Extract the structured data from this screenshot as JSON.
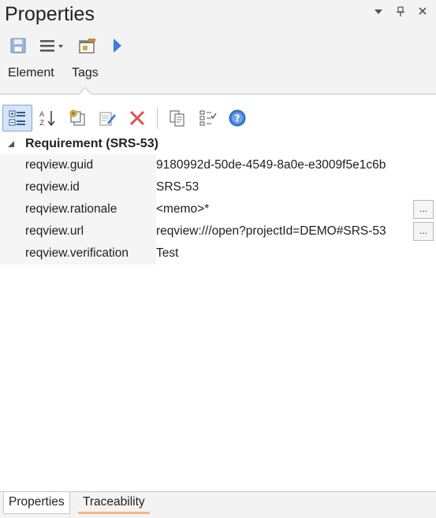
{
  "window": {
    "title": "Properties",
    "controls": {
      "menu": "▼",
      "pin": "📌",
      "close": "✕"
    }
  },
  "toolbar": {
    "icons": [
      "save-icon",
      "menu-list-icon",
      "dropdown-arrow-icon",
      "properties-window-icon",
      "play-icon"
    ]
  },
  "top_tabs": [
    {
      "label": "Element"
    },
    {
      "label": "Tags"
    }
  ],
  "tag_toolbar": {
    "icons": [
      "categorized-view-icon",
      "sort-alphabetical-icon",
      "new-tag-icon",
      "edit-tag-icon",
      "delete-icon",
      "copy-tags-icon",
      "tag-options-icon",
      "help-icon"
    ]
  },
  "grid": {
    "group": {
      "label": "Requirement (SRS-53)"
    },
    "rows": [
      {
        "name": "reqview.guid",
        "value": "9180992d-50de-4549-8a0e-e3009f5e1c6b"
      },
      {
        "name": "reqview.id",
        "value": "SRS-53"
      },
      {
        "name": "reqview.rationale",
        "value": "<memo>*",
        "button": "..."
      },
      {
        "name": "reqview.url",
        "value": "reqview:///open?projectId=DEMO#SRS-53",
        "button": "..."
      },
      {
        "name": "reqview.verification",
        "value": "Test"
      }
    ]
  },
  "bottom_tabs": [
    {
      "label": "Properties"
    },
    {
      "label": "Traceability"
    }
  ],
  "colors": {
    "accent": "#3b7fd6",
    "hover_underline": "#f0b88a",
    "delete_red": "#d9534f"
  }
}
